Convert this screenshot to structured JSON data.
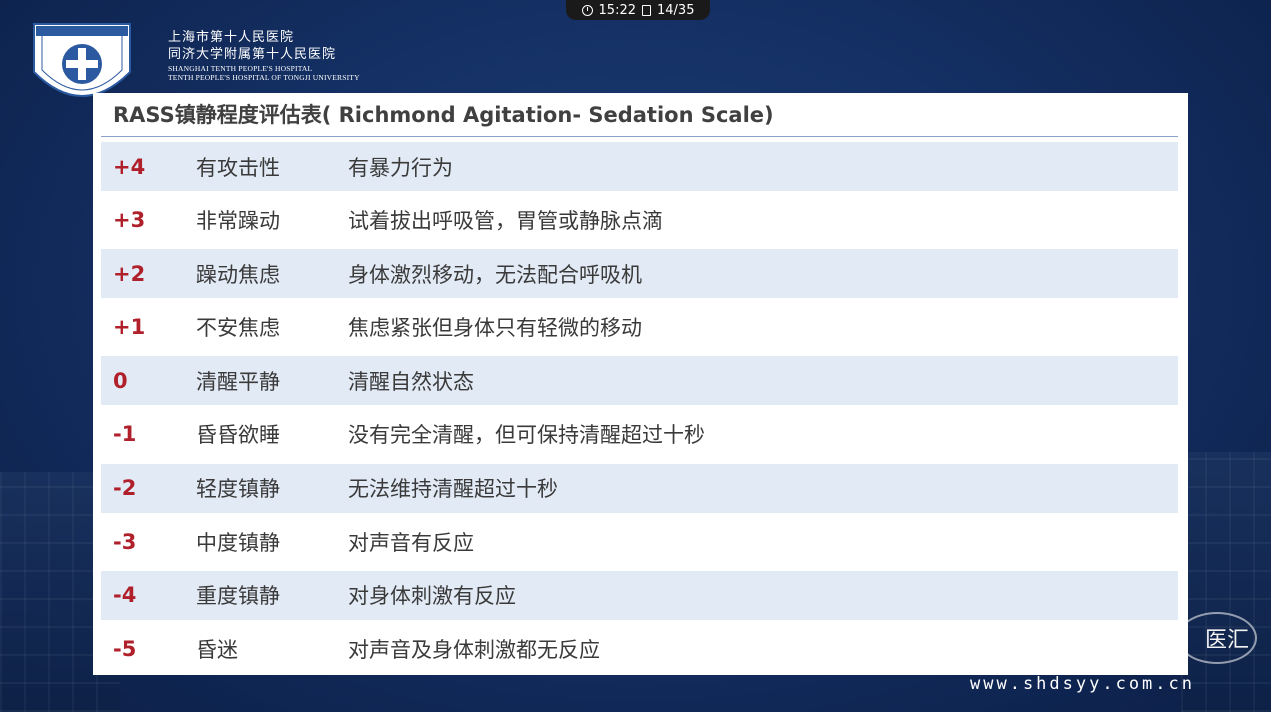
{
  "status": {
    "time": "15:22",
    "page": "14/35",
    "icons": [
      "clock-icon",
      "slide-icon"
    ]
  },
  "hospital": {
    "name_cn": "上海市第十人民医院",
    "affiliation_cn": "同济大学附属第十人民医院",
    "name_en": "SHANGHAI TENTH PEOPLE'S HOSPITAL",
    "affiliation_en": "TENTH PEOPLE'S HOSPITAL OF TONGJI UNIVERSITY",
    "logo_text": "上海市第十人民医院",
    "logo_ring_text": "TENTH PEOPLE'S HOSPITAL OF TONGJI UNIVERSITY"
  },
  "slide": {
    "title": "RASS镇静程度评估表( Richmond Agitation- Sedation Scale)",
    "rows": [
      {
        "score": "+4",
        "term": "有攻击性",
        "description": "有暴力行为"
      },
      {
        "score": "+3",
        "term": "非常躁动",
        "description": "试着拔出呼吸管，胃管或静脉点滴"
      },
      {
        "score": "+2",
        "term": "躁动焦虑",
        "description": "身体激烈移动，无法配合呼吸机"
      },
      {
        "score": "+1",
        "term": "不安焦虑",
        "description": "焦虑紧张但身体只有轻微的移动"
      },
      {
        "score": "0",
        "term": "清醒平静",
        "description": "清醒自然状态"
      },
      {
        "score": "-1",
        "term": "昏昏欲睡",
        "description": "没有完全清醒，但可保持清醒超过十秒"
      },
      {
        "score": "-2",
        "term": "轻度镇静",
        "description": "无法维持清醒超过十秒"
      },
      {
        "score": "-3",
        "term": "中度镇静",
        "description": "对声音有反应"
      },
      {
        "score": "-4",
        "term": "重度镇静",
        "description": "对身体刺激有反应"
      },
      {
        "score": "-5",
        "term": "昏迷",
        "description": "对声音及身体刺激都无反应"
      }
    ]
  },
  "watermark": {
    "brand": "医汇",
    "url": "www.shdsyy.com.cn"
  },
  "colors": {
    "score": "#b0202a",
    "row_shade": "#e2eaf5",
    "background": "#143064"
  }
}
